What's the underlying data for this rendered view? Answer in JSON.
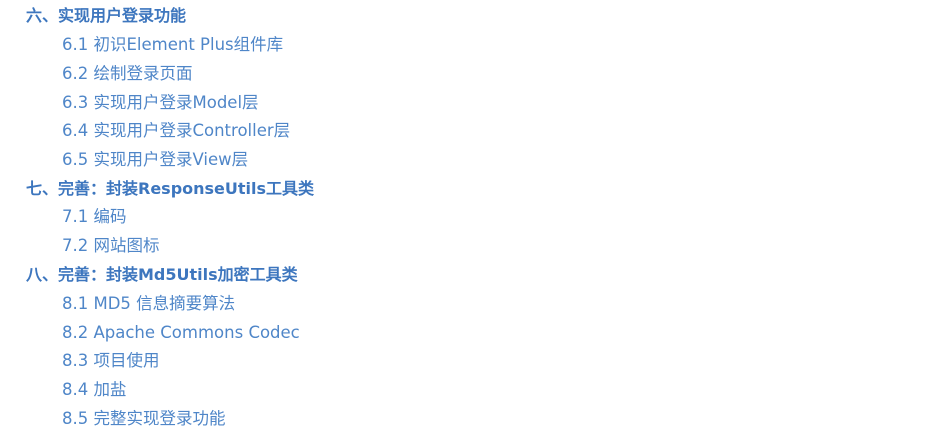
{
  "toc": {
    "sections": [
      {
        "title": "六、实现用户登录功能",
        "items": [
          "6.1 初识Element Plus组件库",
          "6.2 绘制登录页面",
          "6.3 实现用户登录Model层",
          "6.4 实现用户登录Controller层",
          "6.5 实现用户登录View层"
        ]
      },
      {
        "title": "七、完善：封装ResponseUtils工具类",
        "items": [
          "7.1 编码",
          "7.2 网站图标"
        ]
      },
      {
        "title": "八、完善：封装Md5Utils加密工具类",
        "items": [
          "8.1 MD5 信息摘要算法",
          "8.2 Apache Commons Codec",
          "8.3 项目使用",
          "8.4 加盐",
          "8.5 完整实现登录功能"
        ]
      }
    ],
    "link_color": "#4a7fc1"
  }
}
